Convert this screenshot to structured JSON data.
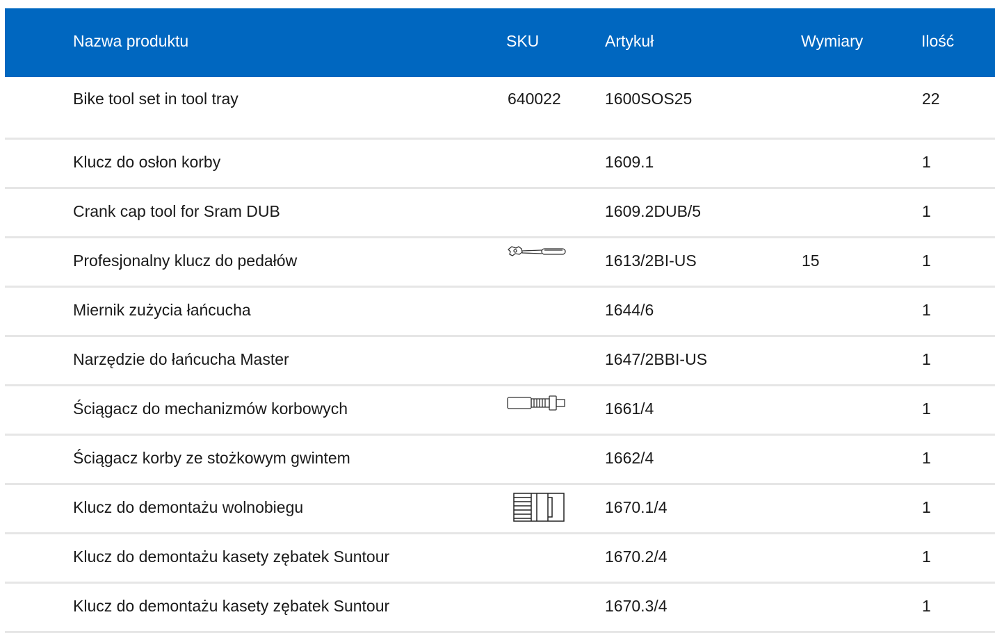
{
  "colors": {
    "header_bg": "#0067c0",
    "header_text": "#ffffff",
    "row_divider": "#e6e6e6"
  },
  "header": {
    "name": "Nazwa produktu",
    "sku": "SKU",
    "article": "Artykuł",
    "dimensions": "Wymiary",
    "quantity": "Ilość"
  },
  "rows": [
    {
      "name": "Bike tool set in tool tray",
      "sku": "640022",
      "article": "1600SOS25",
      "dimensions": "",
      "quantity": "22"
    },
    {
      "name": "Klucz do osłon korby",
      "sku": "",
      "article": "1609.1",
      "dimensions": "",
      "quantity": "1"
    },
    {
      "name": "Crank cap tool for Sram DUB",
      "sku": "",
      "article": "1609.2DUB/5",
      "dimensions": "",
      "quantity": "1"
    },
    {
      "name": "Profesjonalny klucz do pedałów",
      "sku": "",
      "image": "pedal-wrench-icon",
      "article": "1613/2BI-US",
      "dimensions": "15",
      "quantity": "1"
    },
    {
      "name": "Miernik zużycia łańcucha",
      "sku": "",
      "article": "1644/6",
      "dimensions": "",
      "quantity": "1"
    },
    {
      "name": "Narzędzie do łańcucha Master",
      "sku": "",
      "article": "1647/2BBI-US",
      "dimensions": "",
      "quantity": "1"
    },
    {
      "name": "Ściągacz do mechanizmów korbowych",
      "sku": "",
      "image": "crank-puller-icon",
      "article": "1661/4",
      "dimensions": "",
      "quantity": "1"
    },
    {
      "name": "Ściągacz korby ze stożkowym gwintem",
      "sku": "",
      "article": "1662/4",
      "dimensions": "",
      "quantity": "1"
    },
    {
      "name": "Klucz do demontażu wolnobiegu",
      "sku": "",
      "image": "freewheel-remover-icon",
      "article": "1670.1/4",
      "dimensions": "",
      "quantity": "1"
    },
    {
      "name": "Klucz do demontażu kasety zębatek Suntour",
      "sku": "",
      "article": "1670.2/4",
      "dimensions": "",
      "quantity": "1"
    },
    {
      "name": "Klucz do demontażu kasety zębatek Suntour",
      "sku": "",
      "article": "1670.3/4",
      "dimensions": "",
      "quantity": "1"
    }
  ]
}
